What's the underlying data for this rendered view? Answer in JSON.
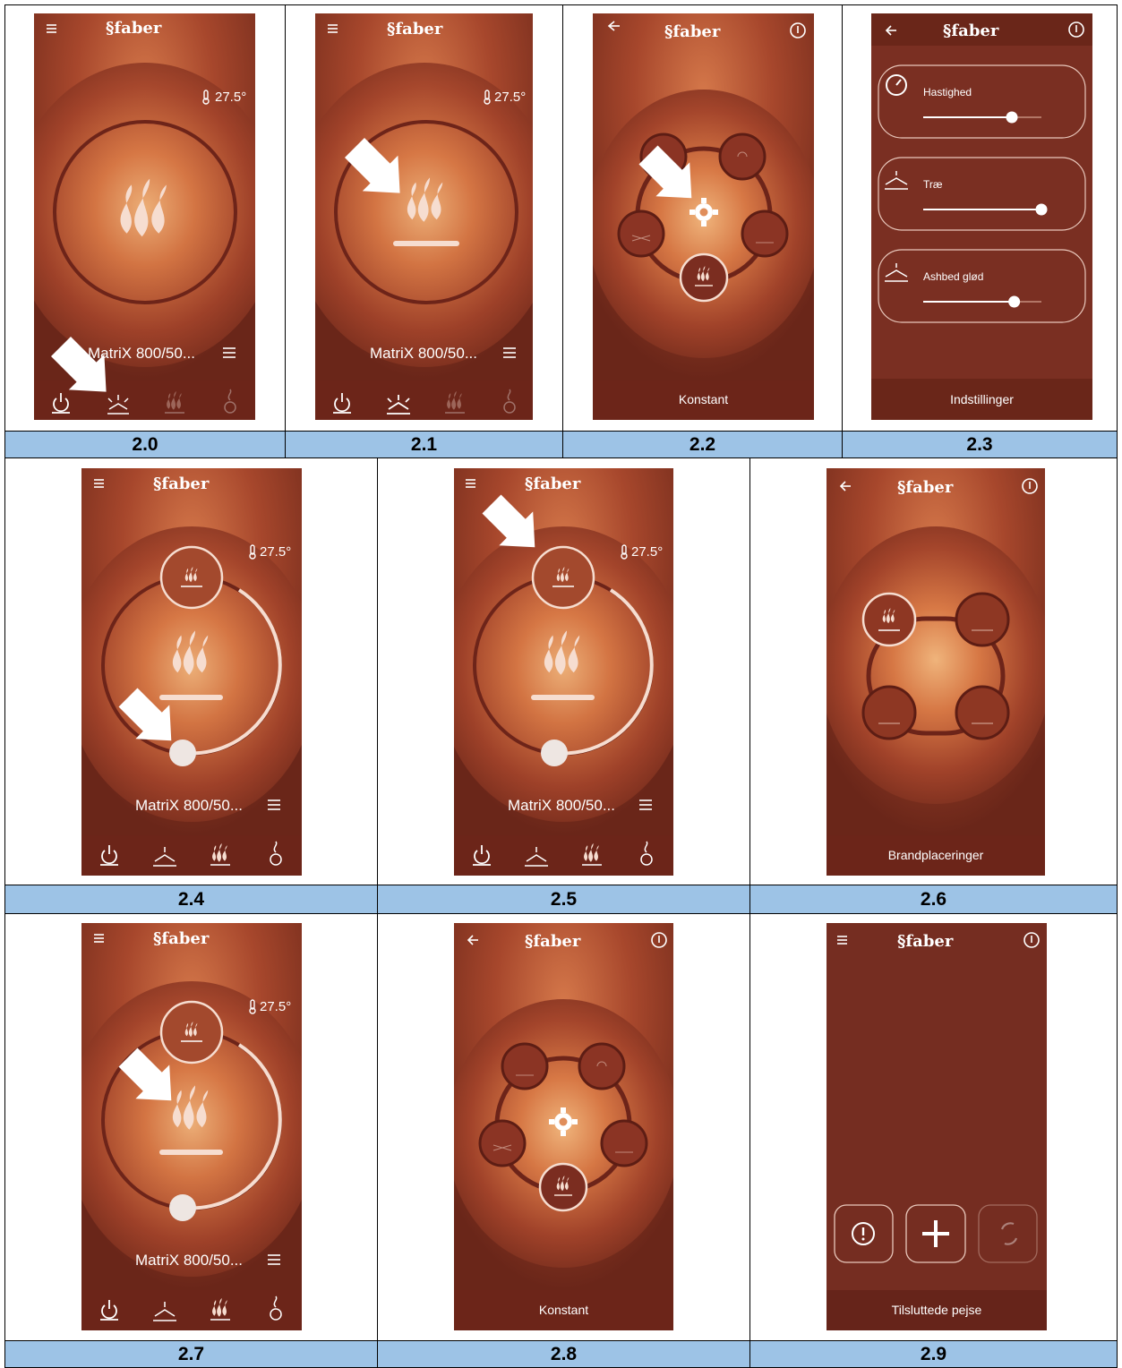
{
  "brand": "faber",
  "temperature": "27.5°",
  "device_name": "MatriX 800/50...",
  "captions": [
    "2.0",
    "2.1",
    "2.2",
    "2.3",
    "2.4",
    "2.5",
    "2.6",
    "2.7",
    "2.8",
    "2.9"
  ],
  "screens": {
    "s22_title": "Konstant",
    "s23_title": "Indstillinger",
    "s23_rows": [
      {
        "label": "Hastighed",
        "level": 0.75
      },
      {
        "label": "Træ",
        "level": 1.0
      },
      {
        "label": "Ashbed glød",
        "level": 0.77
      }
    ],
    "s26_title": "Brandplaceringer",
    "s28_title": "Konstant",
    "s29_title": "Tilsluttede pejse"
  },
  "colors": {
    "app_background": "#7a2f22",
    "glow_center": "#f1b179",
    "caption_fill": "#9dc3e6"
  },
  "icons": [
    "menu-icon",
    "back-icon",
    "power-icon",
    "flame-icon",
    "thermometer-icon",
    "list-icon",
    "gear-icon",
    "ember-icon",
    "alert-icon",
    "plus-icon",
    "refresh-icon"
  ]
}
